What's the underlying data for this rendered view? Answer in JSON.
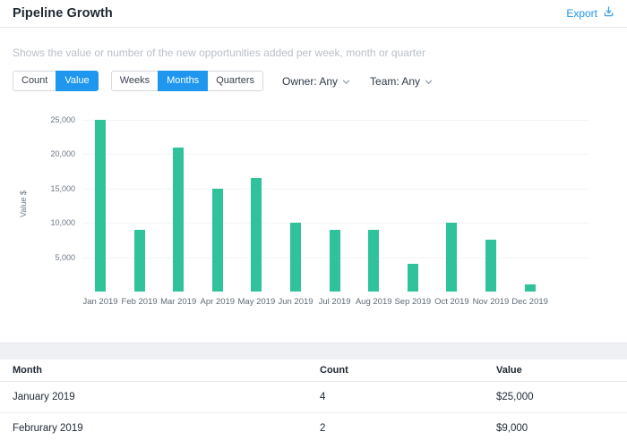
{
  "header": {
    "title": "Pipeline Growth",
    "export_label": "Export"
  },
  "subtitle": "Shows the value or number of the new opportunities added per week, month or quarter",
  "controls": {
    "metric_toggle": {
      "group": "metric",
      "options": [
        "Count",
        "Value"
      ],
      "selected": "Value"
    },
    "period_toggle": {
      "group": "period",
      "options": [
        "Weeks",
        "Months",
        "Quarters"
      ],
      "selected": "Months"
    },
    "filters": [
      {
        "name": "owner",
        "label": "Owner:",
        "value": "Any"
      },
      {
        "name": "team",
        "label": "Team:",
        "value": "Any"
      }
    ]
  },
  "chart_data": {
    "type": "bar",
    "title": "",
    "xlabel": "",
    "ylabel": "Value $",
    "categories": [
      "Jan 2019",
      "Feb 2019",
      "Mar 2019",
      "Apr 2019",
      "May 2019",
      "Jun 2019",
      "Jul 2019",
      "Aug 2019",
      "Sep 2019",
      "Oct 2019",
      "Nov 2019",
      "Dec 2019"
    ],
    "values": [
      25000,
      9000,
      21000,
      15000,
      16500,
      10000,
      9000,
      9000,
      4000,
      10000,
      7500,
      1000
    ],
    "yticks": [
      5000,
      10000,
      15000,
      20000,
      25000
    ],
    "ytick_labels": [
      "5,000",
      "10,000",
      "15,000",
      "20,000",
      "25,000"
    ],
    "ylim": [
      0,
      25000
    ],
    "bar_color": "#2fc29b",
    "grid": "horizontal",
    "legend": "none"
  },
  "table": {
    "columns": [
      "Month",
      "Count",
      "Value"
    ],
    "rows": [
      [
        "January 2019",
        "4",
        "$25,000"
      ],
      [
        "Februrary 2019",
        "2",
        "$9,000"
      ]
    ]
  },
  "colors": {
    "accent_blue": "#1f97ef",
    "bar_teal": "#2fc29b",
    "subtitle_gray": "#b9bfc9"
  }
}
